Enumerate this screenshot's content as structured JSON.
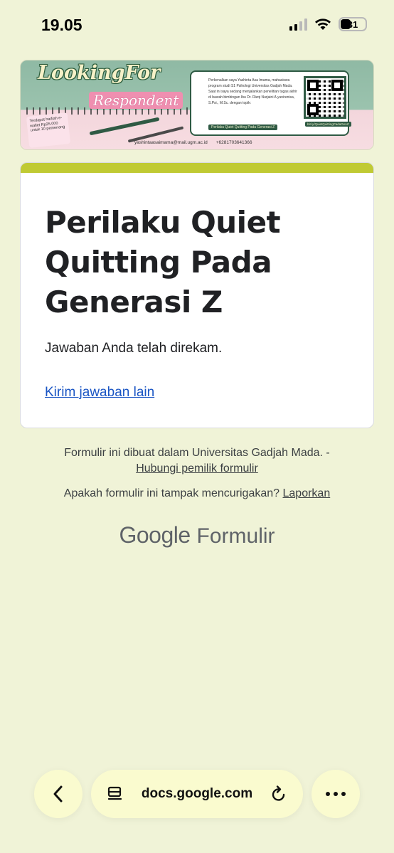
{
  "status_bar": {
    "time": "19.05",
    "battery": "31",
    "icons": [
      "signal-icon",
      "wifi-icon",
      "battery-icon"
    ]
  },
  "banner": {
    "looking_for": "LookingFor",
    "respondent": "Respondent",
    "note": "Terdapat hadiah e-wallet Rp25.000 untuk 10 pemenang",
    "intro_text": "Perkenalkan saya Yashinta Asa Imama, mahasiswa program studi S1 Psikologi Universitas Gadjah Mada. Saat ini saya sedang menjalankan penelitian tugas akhir di bawah bimbingan Ibu Dr. Rizqi Nurjaini A yunirenisa, S.Psi., M.Sc. dengan topik:",
    "topic_tag": "Perilaku Quiet Quitting Pada Generasi Z",
    "qr_link": "bit.ly/QuietQuittingPadaGenZ",
    "email": "yashintaasaimama@mail.ugm.ac.id",
    "phone": "+6281703641366"
  },
  "form": {
    "title": "Perilaku Quiet Quitting Pada Generasi Z",
    "message": "Jawaban Anda telah direkam.",
    "submit_another": "Kirim jawaban lain",
    "accent_color": "#c0ca33"
  },
  "footer": {
    "created_in": "Formulir ini dibuat dalam Universitas Gadjah Mada. -",
    "contact_owner": "Hubungi pemilik formulir",
    "suspicious": "Apakah formulir ini tampak mencurigakan?",
    "report": "Laporkan",
    "brand_google": "Google",
    "brand_forms": "Formulir"
  },
  "browser_bar": {
    "url": "docs.google.com",
    "back_icon": "chevron-left-icon",
    "page_icon": "page-menu-icon",
    "reload_icon": "reload-icon",
    "more_icon": "more-icon"
  }
}
